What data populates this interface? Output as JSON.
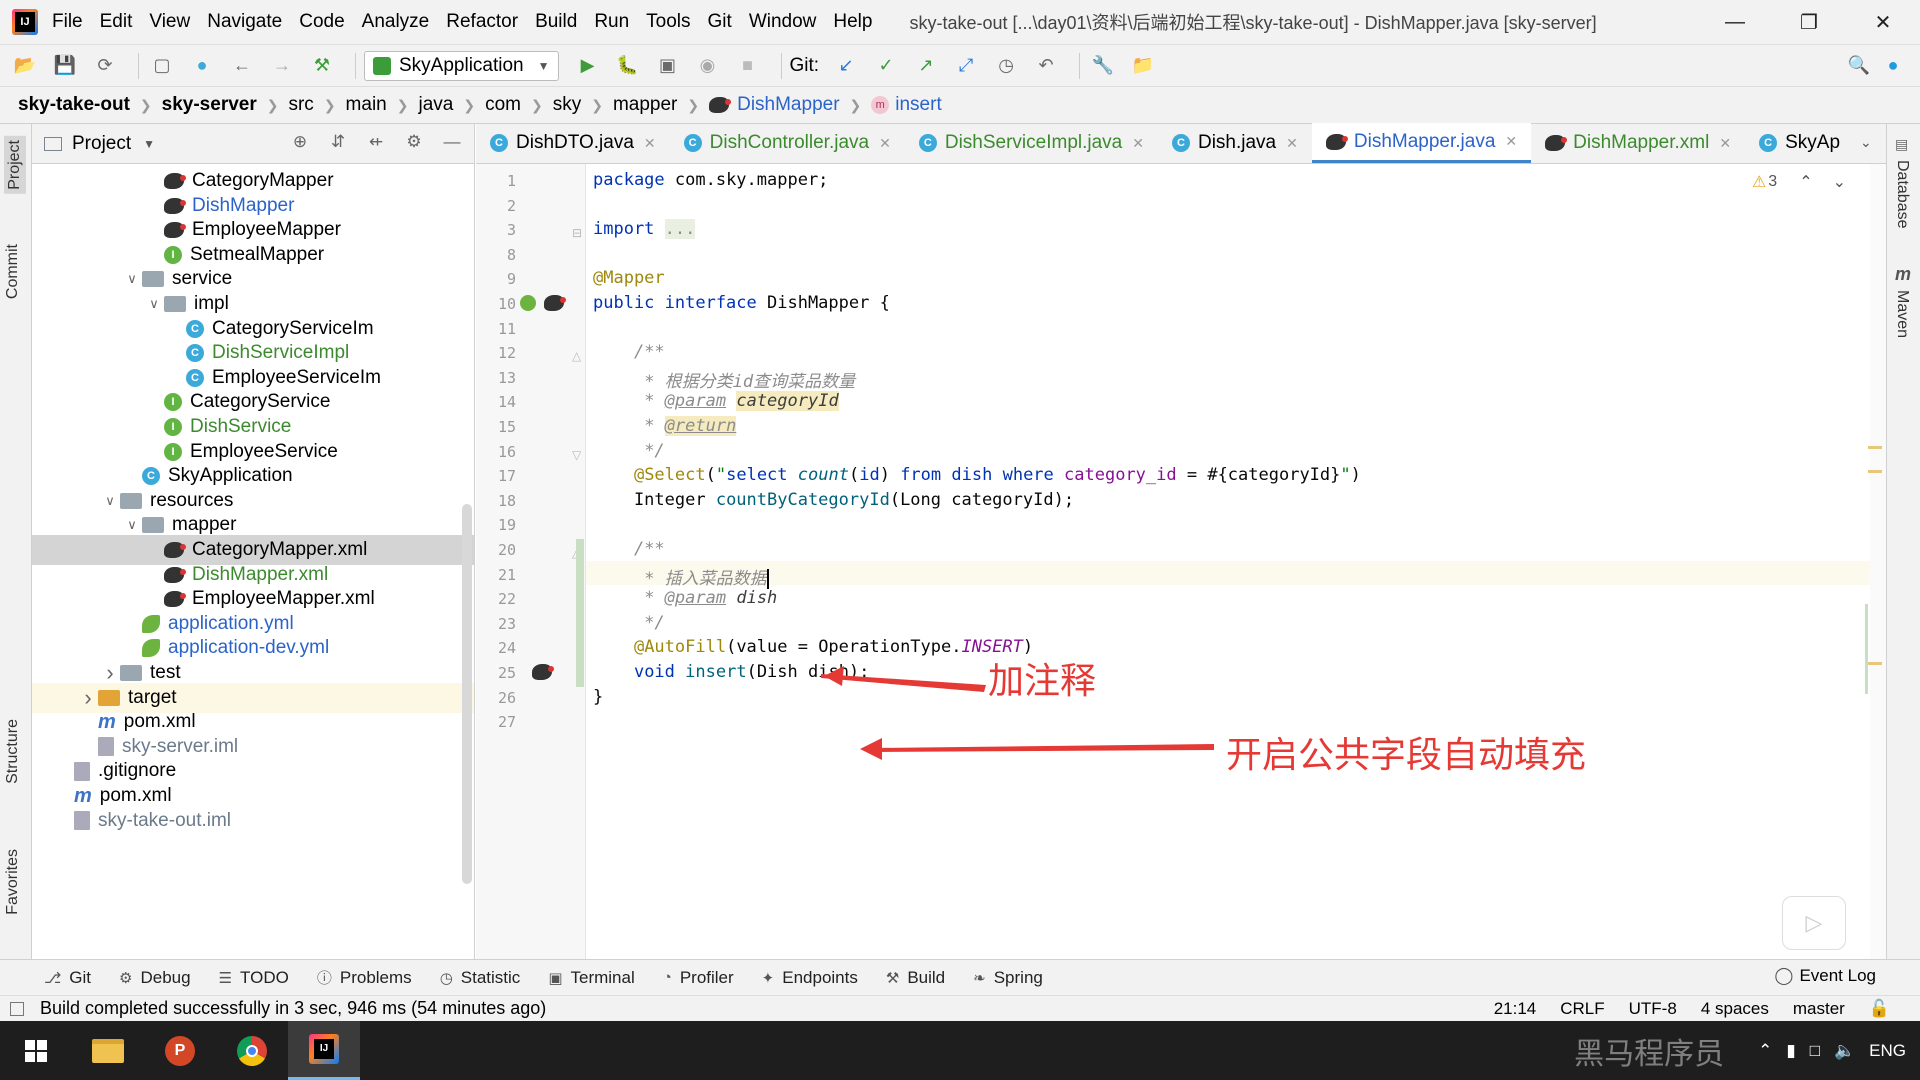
{
  "window": {
    "title": "sky-take-out [...\\day01\\资料\\后端初始工程\\sky-take-out] - DishMapper.java [sky-server]",
    "menu": [
      "File",
      "Edit",
      "View",
      "Navigate",
      "Code",
      "Analyze",
      "Refactor",
      "Build",
      "Run",
      "Tools",
      "Git",
      "Window",
      "Help"
    ]
  },
  "toolbar": {
    "run_config": "SkyApplication",
    "git_label": "Git:"
  },
  "breadcrumb": [
    "sky-take-out",
    "sky-server",
    "src",
    "main",
    "java",
    "com",
    "sky",
    "mapper",
    "DishMapper",
    "insert"
  ],
  "left_tabs": [
    "Project",
    "Commit",
    "Structure",
    "Favorites"
  ],
  "right_tabs": [
    "Database",
    "Maven"
  ],
  "project": {
    "title": "Project",
    "tree": [
      {
        "label": "CategoryMapper",
        "icon": "mybatis-icon",
        "indent": 3,
        "color": "normal"
      },
      {
        "label": "DishMapper",
        "icon": "mybatis-icon",
        "indent": 3,
        "color": "blue"
      },
      {
        "label": "EmployeeMapper",
        "icon": "mybatis-icon",
        "indent": 3,
        "color": "normal"
      },
      {
        "label": "SetmealMapper",
        "icon": "interface-icon",
        "indent": 3,
        "color": "normal"
      },
      {
        "label": "service",
        "icon": "folder-icon",
        "indent": 2,
        "arrow": "down",
        "color": "normal"
      },
      {
        "label": "impl",
        "icon": "folder-icon",
        "indent": 3,
        "arrow": "down",
        "color": "normal"
      },
      {
        "label": "CategoryServiceIm",
        "icon": "class-icon",
        "indent": 4,
        "color": "normal"
      },
      {
        "label": "DishServiceImpl",
        "icon": "class-icon",
        "indent": 4,
        "color": "green"
      },
      {
        "label": "EmployeeServiceIm",
        "icon": "class-icon",
        "indent": 4,
        "color": "normal"
      },
      {
        "label": "CategoryService",
        "icon": "interface-icon",
        "indent": 3,
        "color": "normal"
      },
      {
        "label": "DishService",
        "icon": "interface-icon",
        "indent": 3,
        "color": "green"
      },
      {
        "label": "EmployeeService",
        "icon": "interface-icon",
        "indent": 3,
        "color": "normal"
      },
      {
        "label": "SkyApplication",
        "icon": "spring-class-icon",
        "indent": 2,
        "color": "normal"
      },
      {
        "label": "resources",
        "icon": "folder-icon",
        "indent": 1,
        "arrow": "down",
        "color": "normal"
      },
      {
        "label": "mapper",
        "icon": "folder-icon",
        "indent": 2,
        "arrow": "down",
        "color": "normal"
      },
      {
        "label": "CategoryMapper.xml",
        "icon": "mybatis-icon",
        "indent": 3,
        "color": "normal",
        "selected": true
      },
      {
        "label": "DishMapper.xml",
        "icon": "mybatis-icon",
        "indent": 3,
        "color": "green"
      },
      {
        "label": "EmployeeMapper.xml",
        "icon": "mybatis-icon",
        "indent": 3,
        "color": "normal"
      },
      {
        "label": "application.yml",
        "icon": "spring-leaf-icon",
        "indent": 2,
        "color": "blue"
      },
      {
        "label": "application-dev.yml",
        "icon": "spring-leaf-icon",
        "indent": 2,
        "color": "blue"
      },
      {
        "label": "test",
        "icon": "folder-icon",
        "indent": 1,
        "arrow": "right",
        "color": "normal"
      },
      {
        "label": "target",
        "icon": "folder-orange-icon",
        "indent": 0,
        "arrow": "right",
        "color": "normal",
        "highlight": true
      },
      {
        "label": "pom.xml",
        "icon": "maven-icon",
        "indent": 0,
        "color": "normal"
      },
      {
        "label": "sky-server.iml",
        "icon": "file-icon",
        "indent": 0,
        "color": "gray"
      },
      {
        "label": ".gitignore",
        "icon": "file-icon",
        "indent": -1,
        "color": "normal"
      },
      {
        "label": "pom.xml",
        "icon": "maven-icon",
        "indent": -1,
        "color": "normal"
      },
      {
        "label": "sky-take-out.iml",
        "icon": "file-icon",
        "indent": -1,
        "color": "gray"
      }
    ]
  },
  "tabs": [
    {
      "label": "DishDTO.java",
      "icon": "class-icon",
      "color": "normal"
    },
    {
      "label": "DishController.java",
      "icon": "class-icon",
      "color": "green"
    },
    {
      "label": "DishServiceImpl.java",
      "icon": "class-icon",
      "color": "green"
    },
    {
      "label": "Dish.java",
      "icon": "class-icon",
      "color": "normal"
    },
    {
      "label": "DishMapper.java",
      "icon": "mybatis-icon",
      "color": "blue",
      "active": true
    },
    {
      "label": "DishMapper.xml",
      "icon": "mybatis-icon",
      "color": "green"
    },
    {
      "label": "SkyAp",
      "icon": "spring-class-icon",
      "color": "normal"
    }
  ],
  "editor": {
    "warnings_count": "3",
    "lines": [
      {
        "n": "1",
        "html": "<span class='kw'>package</span> com.sky.mapper;"
      },
      {
        "n": "2",
        "html": ""
      },
      {
        "n": "3",
        "html": "<span class='kw'>import</span> <span class='cm' style='background:#e9f0e1;font-style:normal'>...</span>"
      },
      {
        "n": "8",
        "html": ""
      },
      {
        "n": "9",
        "html": "<span class='ann'>@Mapper</span>"
      },
      {
        "n": "10",
        "html": "<span class='kw'>public interface</span> DishMapper {"
      },
      {
        "n": "11",
        "html": ""
      },
      {
        "n": "12",
        "html": "    <span class='cm'>/**</span>"
      },
      {
        "n": "13",
        "html": "     <span class='cm'>* 根据分类id查询菜品数量</span>"
      },
      {
        "n": "14",
        "html": "     <span class='cm'>* </span><span class='doctag'>@param</span> <span class='docparam'>categoryId</span>"
      },
      {
        "n": "15",
        "html": "     <span class='cm'>* </span><span class='doctag' style='background:#f5ebbf'>@return</span>"
      },
      {
        "n": "16",
        "html": "     <span class='cm'>*/</span>"
      },
      {
        "n": "17",
        "html": "    <span class='ann'>@Select</span>(<span class='str'>\"</span><span class='kw'>select</span> <span class='fn' style='font-style:italic'>count</span>(<span class='kw'>id</span>) <span class='kw'>from</span> <span class='kw'>dish</span> <span class='kw'>where</span> <span class='cst' style='font-style:normal'>category_id</span> = #{categoryId}<span class='str'>\"</span>)"
      },
      {
        "n": "18",
        "html": "    Integer <span class='fn'>countByCategoryId</span>(Long categoryId);"
      },
      {
        "n": "19",
        "html": ""
      },
      {
        "n": "20",
        "html": "    <span class='cm'>/**</span>"
      },
      {
        "n": "21",
        "html": "     <span class='cm'>* 插入菜品数据</span><span class='cursor'></span>"
      },
      {
        "n": "22",
        "html": "     <span class='cm'>* </span><span class='doctag'>@param</span> <span class='cm' style='color:#3d3d3d'>dish</span>"
      },
      {
        "n": "23",
        "html": "     <span class='cm'>*/</span>"
      },
      {
        "n": "24",
        "html": "    <span class='ann'>@AutoFill</span>(value = OperationType.<span class='cst'>INSERT</span>)"
      },
      {
        "n": "25",
        "html": "    <span class='kw'>void</span> <span class='fn'>insert</span>(Dish dish);"
      },
      {
        "n": "26",
        "html": "}"
      },
      {
        "n": "27",
        "html": ""
      }
    ]
  },
  "annotations": {
    "comment_note": "加注释",
    "autofill_note": "开启公共字段自动填充"
  },
  "bottom_tools": [
    {
      "label": "Git",
      "icon": "git-branch-icon"
    },
    {
      "label": "Debug",
      "icon": "bug-icon"
    },
    {
      "label": "TODO",
      "icon": "list-icon"
    },
    {
      "label": "Problems",
      "icon": "info-icon"
    },
    {
      "label": "Statistic",
      "icon": "clock-icon"
    },
    {
      "label": "Terminal",
      "icon": "terminal-icon"
    },
    {
      "label": "Profiler",
      "icon": "gauge-icon"
    },
    {
      "label": "Endpoints",
      "icon": "endpoints-icon"
    },
    {
      "label": "Build",
      "icon": "hammer-icon"
    },
    {
      "label": "Spring",
      "icon": "leaf-icon"
    }
  ],
  "event_log": "Event Log",
  "status": {
    "message": "Build completed successfully in 3 sec, 946 ms (54 minutes ago)",
    "position": "21:14",
    "line_sep": "CRLF",
    "encoding": "UTF-8",
    "indent": "4 spaces",
    "branch": "master"
  },
  "tray": {
    "lang": "ENG"
  },
  "watermark": "黑马程序员"
}
